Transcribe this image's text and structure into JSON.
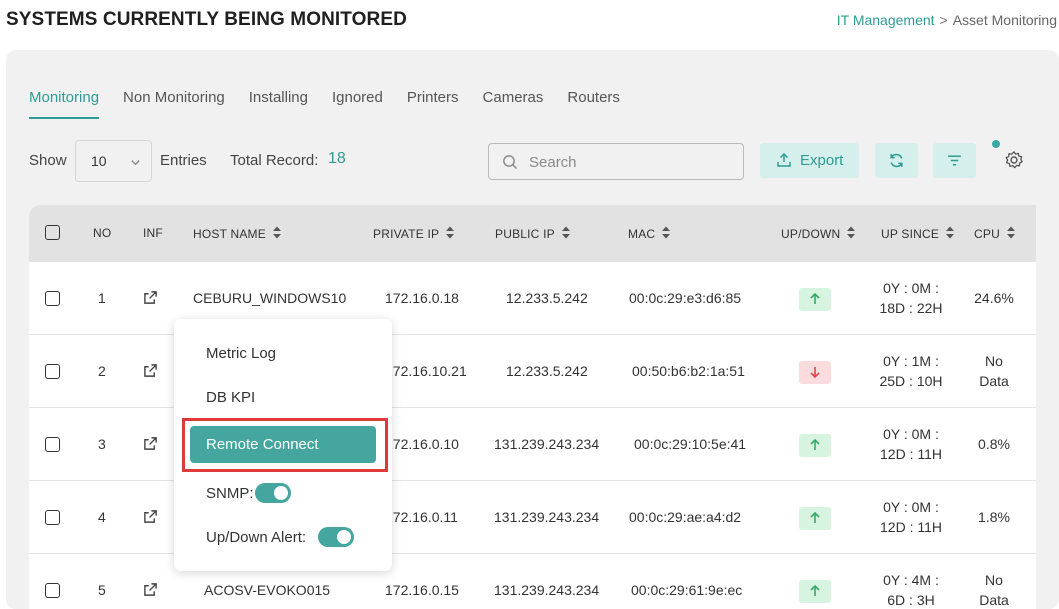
{
  "page": {
    "title": "SYSTEMS CURRENTLY BEING MONITORED",
    "breadcrumb": {
      "parent": "IT Management",
      "separator": ">",
      "current": "Asset Monitoring"
    }
  },
  "tabs": [
    "Monitoring",
    "Non Monitoring",
    "Installing",
    "Ignored",
    "Printers",
    "Cameras",
    "Routers"
  ],
  "active_tab": "Monitoring",
  "controls": {
    "show_label": "Show",
    "entries_value": "10",
    "entries_label": "Entries",
    "total_label": "Total Record:",
    "total_value": "18",
    "search_placeholder": "Search",
    "export_label": "Export"
  },
  "table": {
    "headers": {
      "no": "NO",
      "inf": "INF",
      "host": "HOST NAME",
      "private_ip": "PRIVATE IP",
      "public_ip": "PUBLIC IP",
      "mac": "MAC",
      "updown": "UP/DOWN",
      "upsince": "UP SINCE",
      "cpu": "CPU"
    },
    "rows": [
      {
        "no": "1",
        "host": "CEBURU_WINDOWS10",
        "private_ip": "172.16.0.18",
        "public_ip": "12.233.5.242",
        "mac": "00:0c:29:e3:d6:85",
        "status": "up",
        "since_1": "0Y : 0M :",
        "since_2": "18D : 22H",
        "cpu_1": "24.6%",
        "cpu_2": ""
      },
      {
        "no": "2",
        "host": "",
        "private_ip": "172.16.10.21",
        "public_ip": "12.233.5.242",
        "mac": "00:50:b6:b2:1a:51",
        "status": "down",
        "since_1": "0Y : 1M :",
        "since_2": "25D : 10H",
        "cpu_1": "No",
        "cpu_2": "Data"
      },
      {
        "no": "3",
        "host": "",
        "private_ip": "172.16.0.10",
        "public_ip": "131.239.243.234",
        "mac": "00:0c:29:10:5e:41",
        "status": "up",
        "since_1": "0Y : 0M :",
        "since_2": "12D : 11H",
        "cpu_1": "0.8%",
        "cpu_2": ""
      },
      {
        "no": "4",
        "host": "",
        "private_ip": "172.16.0.11",
        "public_ip": "131.239.243.234",
        "mac": "00:0c:29:ae:a4:d2",
        "status": "up",
        "since_1": "0Y : 0M :",
        "since_2": "12D : 11H",
        "cpu_1": "1.8%",
        "cpu_2": ""
      },
      {
        "no": "5",
        "host": "ACOSV-EVOKO015",
        "private_ip": "172.16.0.15",
        "public_ip": "131.239.243.234",
        "mac": "00:0c:29:61:9e:ec",
        "status": "up",
        "since_1": "0Y : 4M :",
        "since_2": "6D : 3H",
        "cpu_1": "No",
        "cpu_2": "Data"
      }
    ]
  },
  "context_menu": {
    "metric_log": "Metric Log",
    "db_kpi": "DB KPI",
    "remote_connect": "Remote Connect",
    "snmp_label": "SNMP:",
    "snmp_on": true,
    "alert_label": "Up/Down Alert:",
    "alert_on": true
  },
  "colors": {
    "accent": "#2f9c94",
    "button_bg": "#d5efec",
    "up": "#d6f4df",
    "down": "#fadcdf",
    "highlight": "#dd3a3a"
  }
}
